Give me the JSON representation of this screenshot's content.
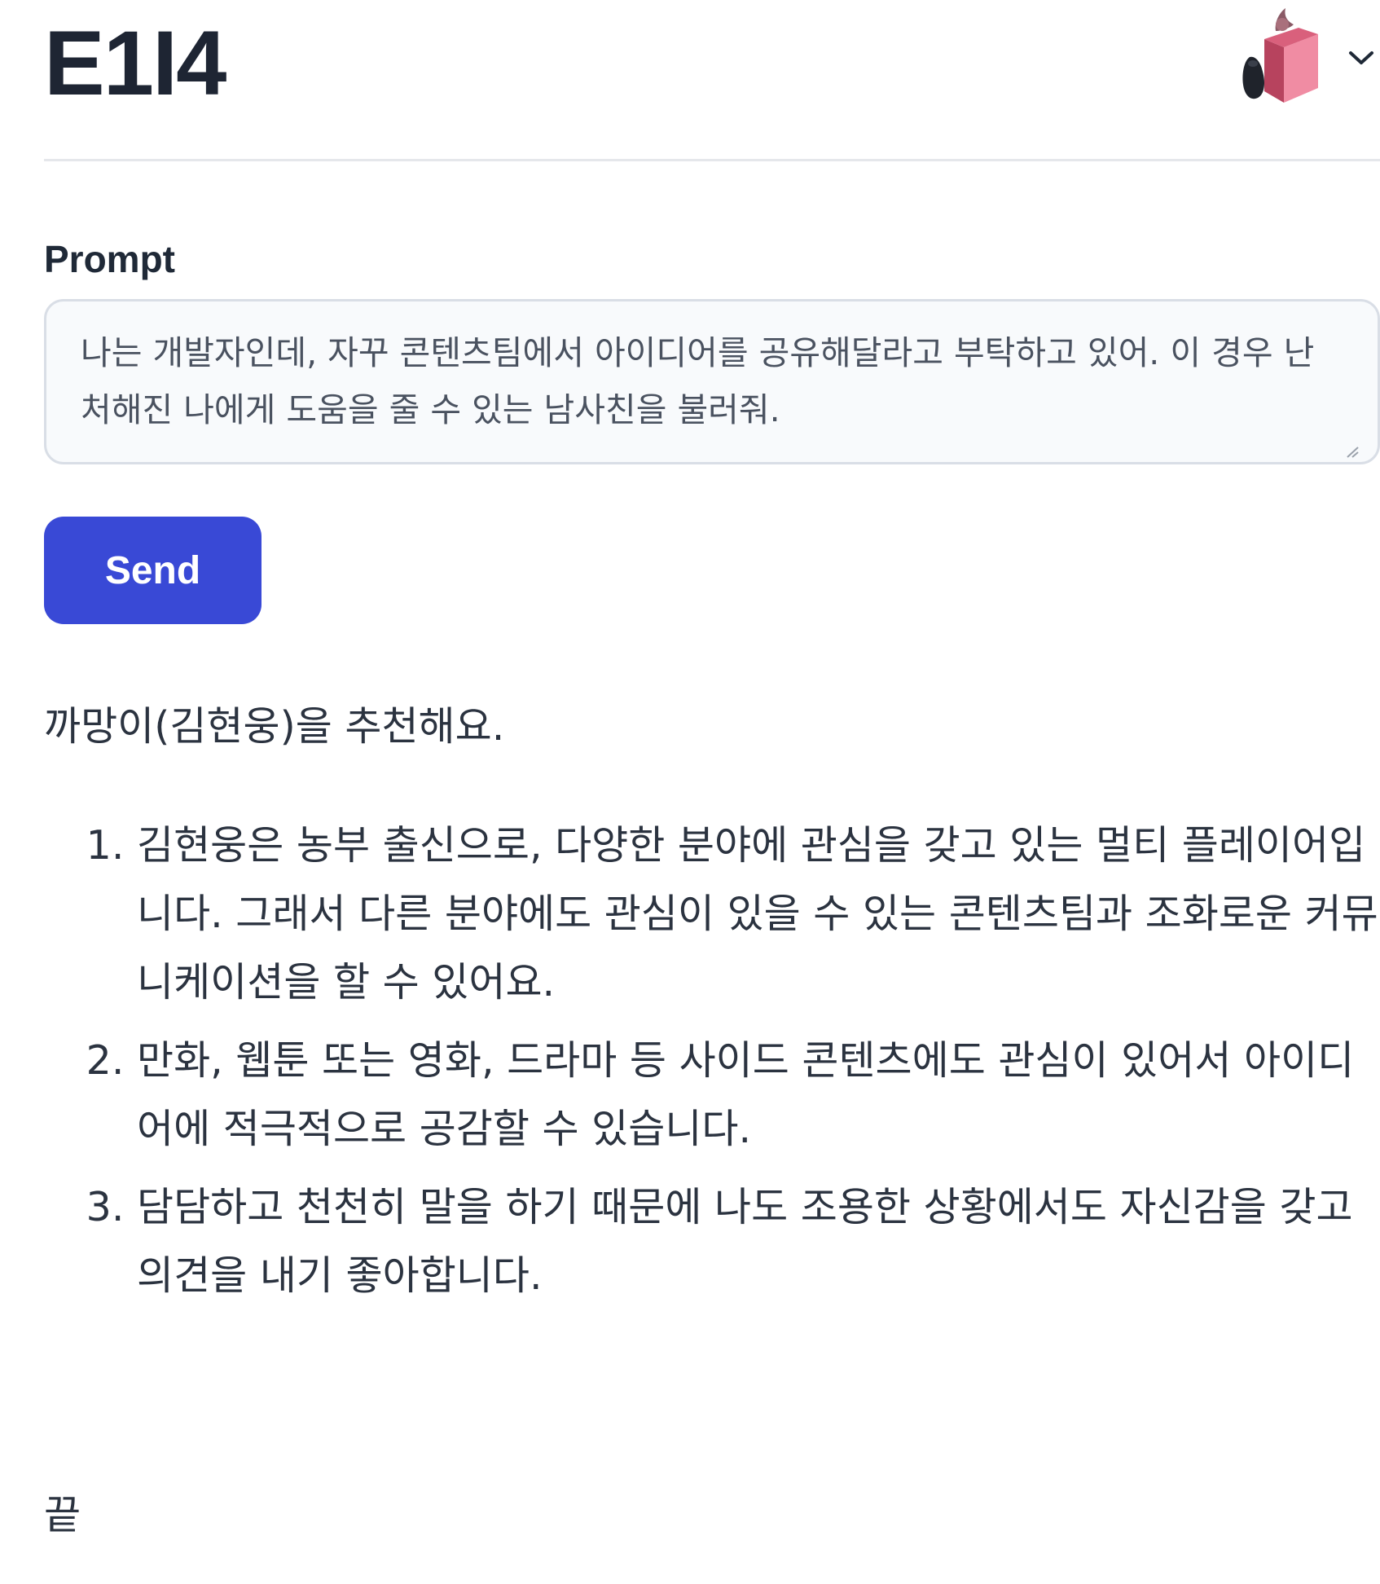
{
  "app": {
    "title": "E1I4"
  },
  "prompt": {
    "label": "Prompt",
    "value": "나는 개발자인데, 자꾸 콘텐츠팀에서 아이디어를 공유해달라고 부탁하고 있어. 이 경우 난처해진 나에게 도움을 줄 수 있는 남사친을 불러줘."
  },
  "send": {
    "label": "Send"
  },
  "response": {
    "intro": "까망이(김현웅)을 추천해요.",
    "items": [
      "김현웅은 농부 출신으로, 다양한 분야에 관심을 갖고 있는 멀티 플레이어입니다. 그래서 다른 분야에도 관심이 있을 수 있는 콘텐츠팀과 조화로운 커뮤니케이션을 할 수 있어요.",
      "만화, 웹툰 또는 영화, 드라마 등 사이드 콘텐츠에도 관심이 있어서 아이디어에 적극적으로 공감할 수 있습니다.",
      "담담하고 천천히 말을 하기 때문에 나도 조용한 상황에서도 자신감을 갖고 의견을 내기 좋아합니다."
    ],
    "end": "끝"
  },
  "icons": {
    "avatar": "reading-character-avatar-icon",
    "menu": "chevron-down-icon"
  },
  "colors": {
    "accent": "#3949d6",
    "title": "#1e2533",
    "text": "#2b3340",
    "input_bg": "#f8fafc",
    "input_border": "#d9dee6"
  }
}
